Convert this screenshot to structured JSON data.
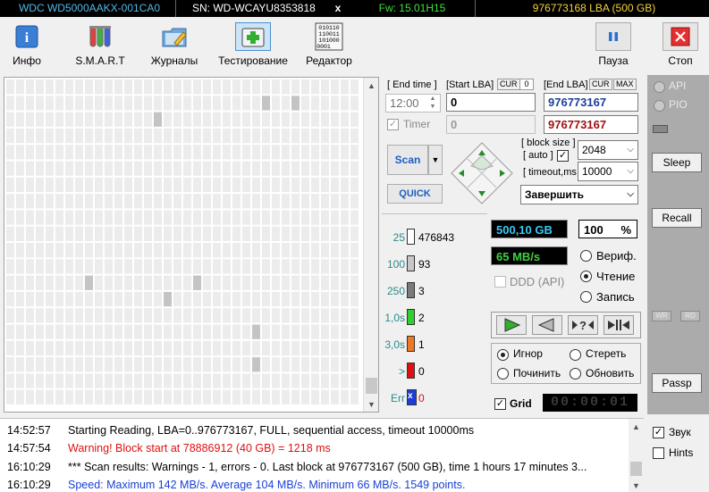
{
  "topbar": {
    "model": "WDC WD5000AAKX-001CA0",
    "serial": "SN: WD-WCAYU8353818",
    "close": "x",
    "firmware": "Fw: 15.01H15",
    "capacity": "976773168 LBA (500 GB)"
  },
  "toolbar": {
    "info": "Инфо",
    "smart": "S.M.A.R.T",
    "logs": "Журналы",
    "test": "Тестирование",
    "editor": "Редактор",
    "pause": "Пауза",
    "stop": "Стоп",
    "editor_icon_text": "010110\n110011\n101000\n0001"
  },
  "grid": {
    "gray_cells": [
      [
        0,
        0
      ],
      [
        0,
        1
      ]
    ]
  },
  "panel": {
    "end_time_label": "[ End time ]",
    "end_time_value": "12:00",
    "timer_label": "Timer",
    "start_lba_label": "[Start LBA]",
    "cur_label": "CUR",
    "start_lba_cur_value": "0",
    "start_lba_value": "0",
    "start_lba_disabled_value": "0",
    "end_lba_label": "[End LBA]",
    "max_label": "MAX",
    "end_lba_value": "976773167",
    "end_lba_value2": "976773167",
    "scan_label": "Scan",
    "quick_label": "QUICK",
    "block_size_label": "[ block size ]",
    "auto_label": "[ auto ]",
    "timeout_label": "[ timeout,ms ]",
    "block_size_value": "2048",
    "timeout_value": "10000",
    "finish_value": "Завершить"
  },
  "stats": {
    "rows": [
      {
        "label": "25",
        "count": "476843",
        "color": "#ffffff"
      },
      {
        "label": "100",
        "count": "93",
        "color": "#c8c8c8"
      },
      {
        "label": "250",
        "count": "3",
        "color": "#7a7a7a"
      },
      {
        "label": "1,0s",
        "count": "2",
        "color": "#2fd02f"
      },
      {
        "label": "3,0s",
        "count": "1",
        "color": "#f07820"
      },
      {
        "label": ">",
        "count": "0",
        "color": "#e01010"
      },
      {
        "label": "Err",
        "count": "0",
        "color": "#1a3fd6"
      }
    ]
  },
  "readouts": {
    "size": "500,10 GB",
    "percent": "100",
    "percent_sign": "%",
    "speed": "65 MB/s",
    "ddd_label": "DDD (API)",
    "verify": "Вериф.",
    "read": "Чтение",
    "write": "Запись",
    "ignore": "Игнор",
    "erase": "Стереть",
    "repair": "Починить",
    "refresh": "Обновить",
    "grid_label": "Grid",
    "timer_display": "00:00:01"
  },
  "side": {
    "api": "API",
    "pio": "PIO",
    "sleep": "Sleep",
    "recall": "Recall",
    "wr": "WR",
    "rd": "RD",
    "passp": "Passp"
  },
  "log": [
    {
      "time": "14:52:57",
      "msg": "Starting Reading, LBA=0..976773167, FULL, sequential access, timeout 10000ms",
      "color": "#000000"
    },
    {
      "time": "14:57:54",
      "msg": "Warning! Block start at 78886912 (40 GB)  = 1218 ms",
      "color": "#e01010"
    },
    {
      "time": "16:10:29",
      "msg": "*** Scan results: Warnings - 1, errors - 0. Last block at 976773167 (500 GB), time 1 hours 17 minutes 3...",
      "color": "#000000"
    },
    {
      "time": "16:10:29",
      "msg": "Speed: Maximum 142 MB/s. Average 104 MB/s. Minimum 66 MB/s. 1549 points.",
      "color": "#1a3fd6"
    }
  ],
  "options": {
    "sound": "Звук",
    "hints": "Hints"
  }
}
